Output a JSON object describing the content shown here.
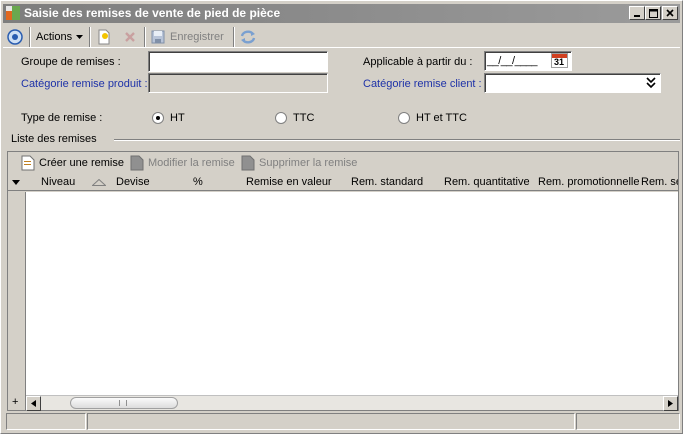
{
  "window": {
    "title": "Saisie des remises de vente de pied de pièce",
    "minimize": "_",
    "maximize": "□",
    "close": "×"
  },
  "toolbar": {
    "actions_label": "Actions",
    "save_label": "Enregistrer"
  },
  "form": {
    "groupe_label": "Groupe de remises :",
    "groupe_value": "",
    "categorie_produit_label": "Catégorie remise produit :",
    "applicable_label": "Applicable à partir du :",
    "date_value": "__/__/____",
    "calendar_day": "31",
    "categorie_client_label": "Catégorie remise client :",
    "type_label": "Type de remise :",
    "type_options": [
      "HT",
      "TTC",
      "HT et TTC"
    ],
    "type_selected": "HT"
  },
  "list": {
    "group_title": "Liste des remises",
    "create_label": "Créer une remise",
    "modify_label": "Modifier la remise",
    "delete_label": "Supprimer la remise",
    "columns": [
      "Niveau",
      "Devise",
      "%",
      "Remise en valeur",
      "Rem. standard",
      "Rem. quantitative",
      "Rem. promotionnelle",
      "Rem. se"
    ],
    "rows": [],
    "add_symbol": "+"
  },
  "colors": {
    "link": "#1e32a8",
    "window_bg": "#d4d0c8"
  }
}
